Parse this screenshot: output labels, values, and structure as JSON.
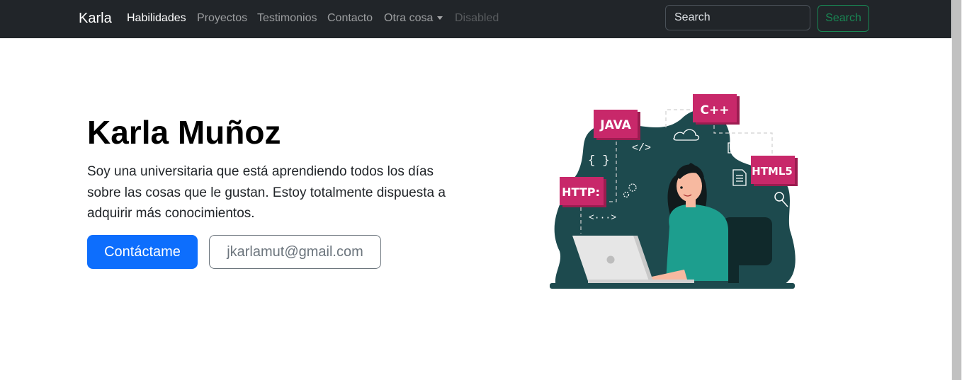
{
  "navbar": {
    "brand": "Karla",
    "links": [
      "Habilidades",
      "Proyectos",
      "Testimonios",
      "Contacto",
      "Otra cosa",
      "Disabled"
    ],
    "search_placeholder": "Search",
    "search_button": "Search"
  },
  "hero": {
    "title": "Karla Muñoz",
    "description": "Soy una universitaria que está aprendiendo todos los días sobre las cosas que le gustan. Estoy totalmente dispuesta a adquirir más conocimientos.",
    "contact_button": "Contáctame",
    "email_button": "jkarlamut@gmail.com"
  },
  "illustration": {
    "tags": [
      "JAVA",
      "C++",
      "HTML5",
      "HTTP:"
    ],
    "code_symbols": [
      "</>",
      "{ }",
      "<···>"
    ],
    "colors": {
      "blob": "#1d4a4e",
      "tag": "#c8286a",
      "shirt": "#1d9e8e",
      "laptop": "#e6e6e6"
    }
  }
}
